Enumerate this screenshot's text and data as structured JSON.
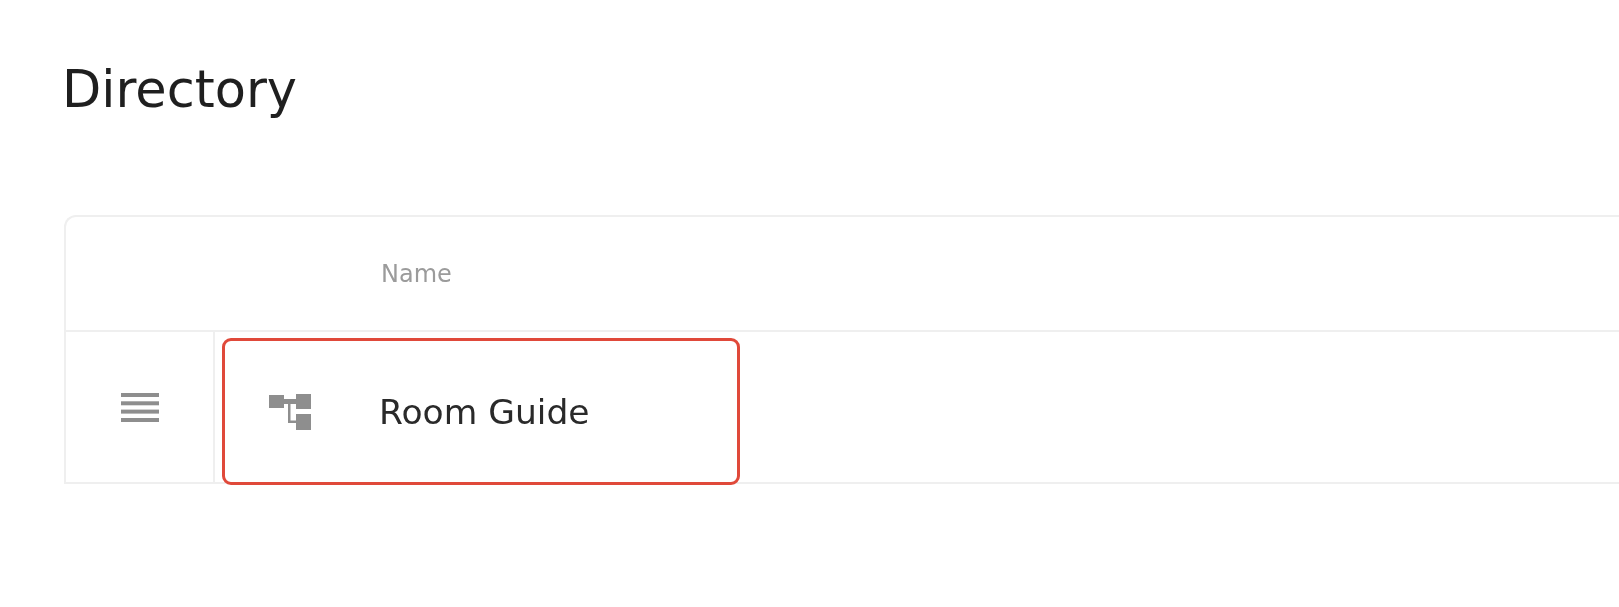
{
  "page": {
    "title": "Directory"
  },
  "table": {
    "columns": [
      {
        "label": "Name"
      }
    ],
    "rows": [
      {
        "name": "Room Guide",
        "selected": true
      }
    ]
  }
}
